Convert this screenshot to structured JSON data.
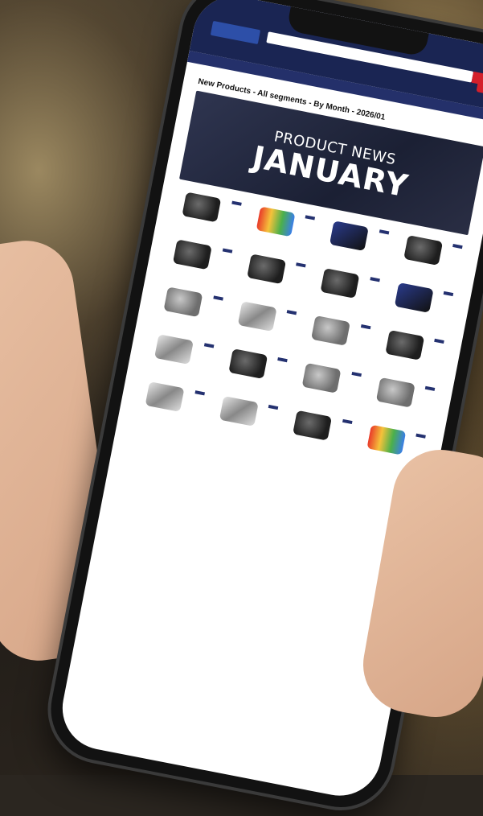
{
  "page": {
    "title": "New Products - All segments - By Month - 2026/01"
  },
  "banner": {
    "line1": "PRODUCT NEWS",
    "line2": "JANUARY"
  }
}
